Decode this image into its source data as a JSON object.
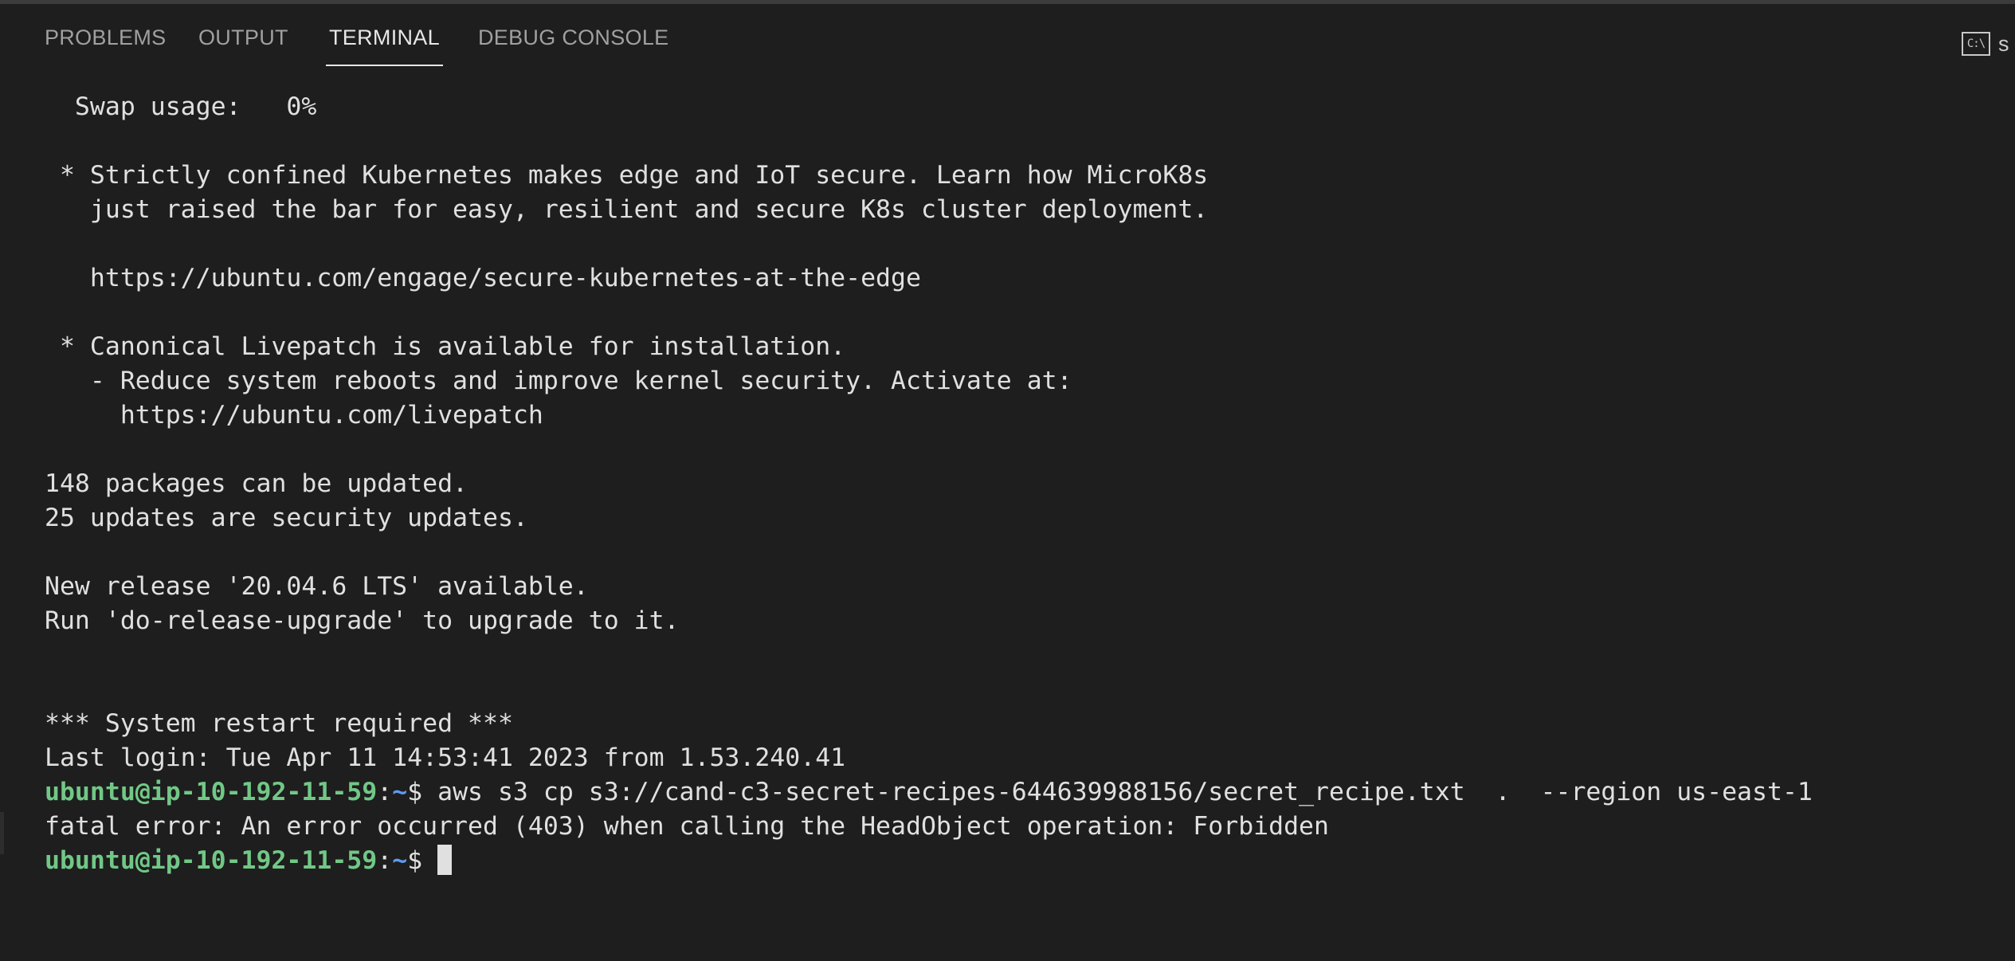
{
  "tabs": {
    "problems": "PROBLEMS",
    "output": "OUTPUT",
    "terminal": "TERMINAL",
    "debug_console": "DEBUG CONSOLE"
  },
  "terminal_type": {
    "icon": "terminal-icon",
    "icon_glyph": "C:\\",
    "label": "s"
  },
  "terminal": {
    "lines": [
      "  Swap usage:   0%",
      "",
      " * Strictly confined Kubernetes makes edge and IoT secure. Learn how MicroK8s",
      "   just raised the bar for easy, resilient and secure K8s cluster deployment.",
      "",
      "   https://ubuntu.com/engage/secure-kubernetes-at-the-edge",
      "",
      " * Canonical Livepatch is available for installation.",
      "   - Reduce system reboots and improve kernel security. Activate at:",
      "     https://ubuntu.com/livepatch",
      "",
      "148 packages can be updated.",
      "25 updates are security updates.",
      "",
      "New release '20.04.6 LTS' available.",
      "Run 'do-release-upgrade' to upgrade to it.",
      "",
      "",
      "*** System restart required ***",
      "Last login: Tue Apr 11 14:53:41 2023 from 1.53.240.41"
    ],
    "prompt": {
      "user_host": "ubuntu@ip-10-192-11-59",
      "colon": ":",
      "path": "~",
      "symbol": "$"
    },
    "command": " aws s3 cp s3://cand-c3-secret-recipes-644639988156/secret_recipe.txt  .  --region us-east-1",
    "error": "fatal error: An error occurred (403) when calling the HeadObject operation: Forbidden",
    "current_input": " "
  },
  "colors": {
    "background": "#1e1e1e",
    "prompt_user": "#71c886",
    "prompt_path": "#5c9bf0",
    "text": "#e0e0e0"
  }
}
